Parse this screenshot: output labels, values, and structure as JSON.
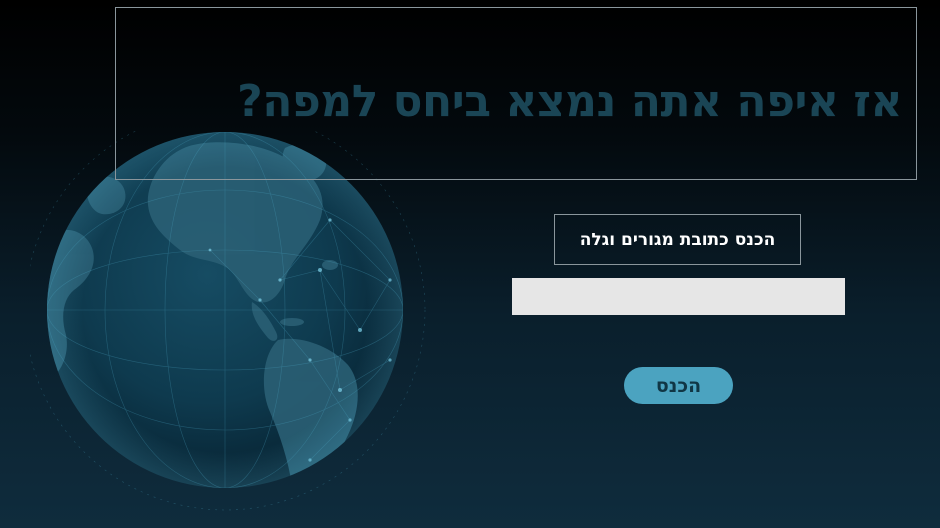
{
  "title": "אז איפה אתה נמצא ביחס למפה?",
  "prompt": {
    "label": "הכנס כתובת מגורים וגלה"
  },
  "address_input": {
    "value": "",
    "placeholder": ""
  },
  "enter_button": {
    "label": "הכנס"
  },
  "colors": {
    "background_top": "#000000",
    "background_bottom": "#0f2c3d",
    "title_text": "#1a4555",
    "box_border": "#8a969c",
    "input_background": "#e6e6e6",
    "button_background": "#4ba3c0",
    "button_text": "#103645",
    "globe_land": "#2a5f74",
    "globe_ocean": "#0e3a4e"
  },
  "decoration": {
    "globe": "world-globe-icon"
  }
}
